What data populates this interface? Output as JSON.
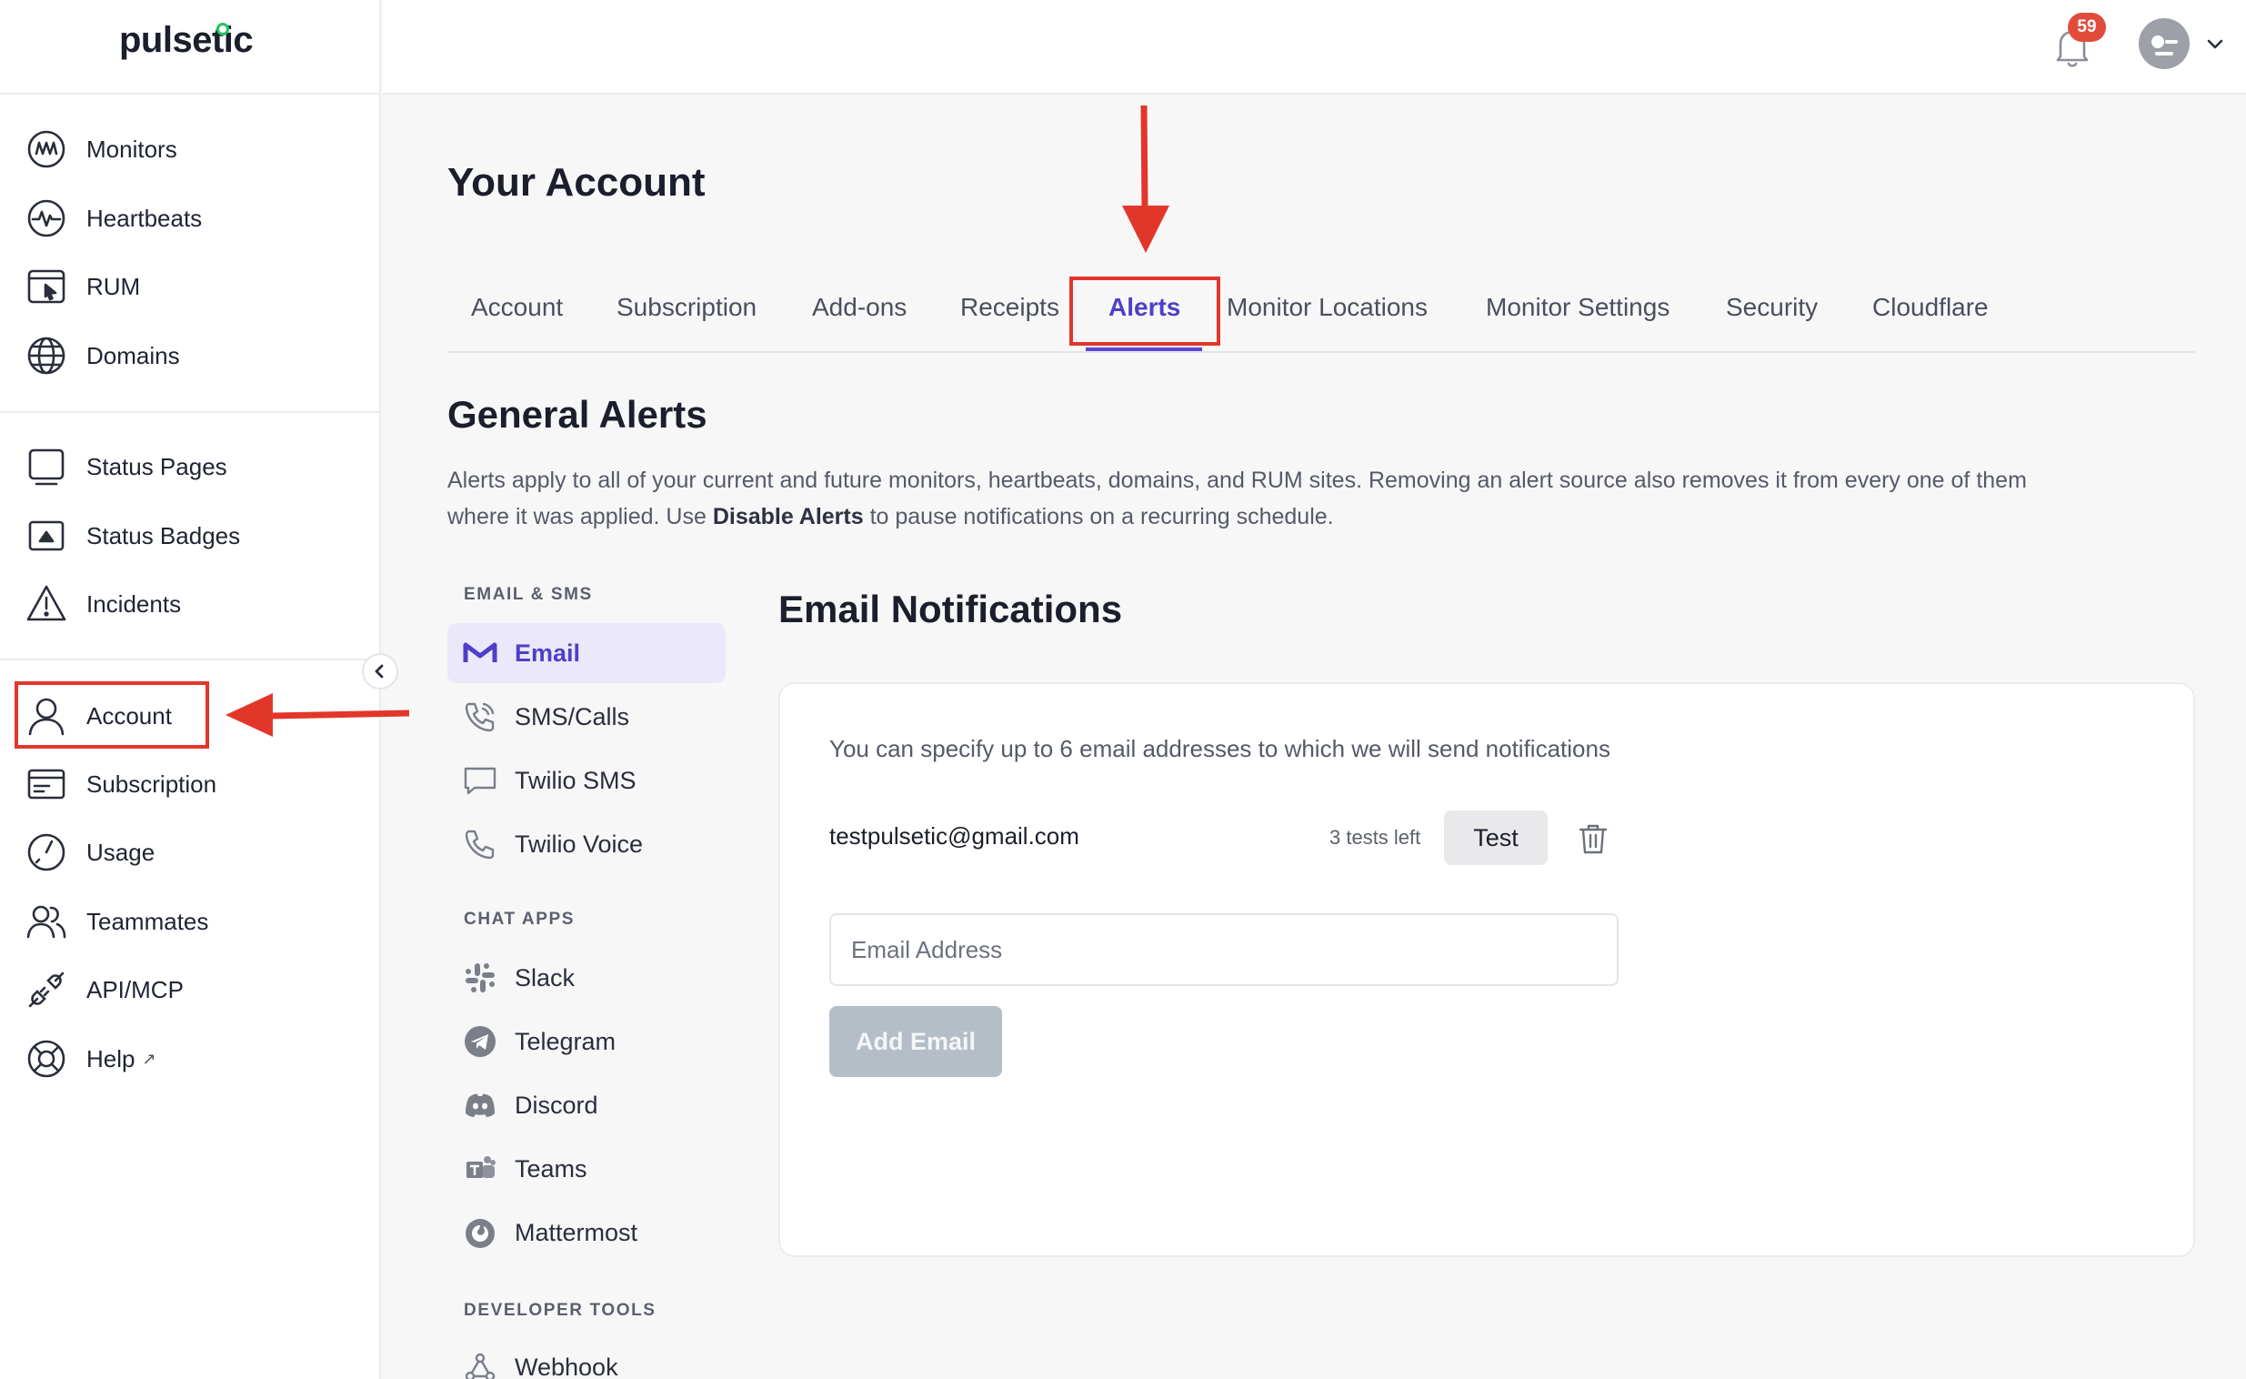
{
  "brand": {
    "name": "pulsetic"
  },
  "sidebar": {
    "groups": [
      [
        {
          "label": "Monitors",
          "icon": "monitors-icon"
        },
        {
          "label": "Heartbeats",
          "icon": "heartbeat-icon"
        },
        {
          "label": "RUM",
          "icon": "rum-icon"
        },
        {
          "label": "Domains",
          "icon": "globe-icon"
        }
      ],
      [
        {
          "label": "Status Pages",
          "icon": "status-page-icon"
        },
        {
          "label": "Status Badges",
          "icon": "status-badge-icon"
        },
        {
          "label": "Incidents",
          "icon": "warning-icon"
        }
      ],
      [
        {
          "label": "Account",
          "icon": "user-icon"
        },
        {
          "label": "Subscription",
          "icon": "card-icon"
        },
        {
          "label": "Usage",
          "icon": "gauge-icon"
        },
        {
          "label": "Teammates",
          "icon": "users-icon"
        },
        {
          "label": "API/MCP",
          "icon": "plug-icon"
        },
        {
          "label": "Help",
          "icon": "lifebuoy-icon",
          "external": "↗"
        }
      ]
    ]
  },
  "topbar": {
    "notification_count": "59"
  },
  "page": {
    "title": "Your Account"
  },
  "tabs": [
    {
      "label": "Account",
      "active": false
    },
    {
      "label": "Subscription",
      "active": false
    },
    {
      "label": "Add-ons",
      "active": false
    },
    {
      "label": "Receipts",
      "active": false
    },
    {
      "label": "Alerts",
      "active": true
    },
    {
      "label": "Monitor Locations",
      "active": false
    },
    {
      "label": "Monitor Settings",
      "active": false
    },
    {
      "label": "Security",
      "active": false
    },
    {
      "label": "Cloudflare",
      "active": false
    }
  ],
  "general": {
    "title": "General Alerts",
    "desc_before": "Alerts apply to all of your current and future monitors, heartbeats, domains, and RUM sites. Removing an alert source also removes it from every one of them where it was applied. Use ",
    "desc_bold": "Disable Alerts",
    "desc_after": " to pause notifications on a recurring schedule."
  },
  "alert_sources": {
    "email_sms_heading": "EMAIL & SMS",
    "email_sms": [
      {
        "label": "Email",
        "icon": "gmail-icon",
        "active": true
      },
      {
        "label": "SMS/Calls",
        "icon": "phone-icon",
        "active": false
      },
      {
        "label": "Twilio SMS",
        "icon": "message-icon",
        "active": false
      },
      {
        "label": "Twilio Voice",
        "icon": "phone-outline-icon",
        "active": false
      }
    ],
    "chat_heading": "CHAT APPS",
    "chat": [
      {
        "label": "Slack",
        "icon": "slack-icon"
      },
      {
        "label": "Telegram",
        "icon": "telegram-icon"
      },
      {
        "label": "Discord",
        "icon": "discord-icon"
      },
      {
        "label": "Teams",
        "icon": "teams-icon"
      },
      {
        "label": "Mattermost",
        "icon": "mattermost-icon"
      }
    ],
    "dev_heading": "DEVELOPER TOOLS",
    "dev": [
      {
        "label": "Webhook",
        "icon": "webhook-icon"
      }
    ]
  },
  "email_panel": {
    "title": "Email Notifications",
    "description": "You can specify up to 6 email addresses to which we will send notifications",
    "address": "testpulsetic@gmail.com",
    "tests_left": "3 tests left",
    "test_label": "Test",
    "input_placeholder": "Email Address",
    "add_label": "Add Email"
  },
  "colors": {
    "accent": "#5b46d6",
    "highlight": "#e3362a",
    "badge": "#e14b3b"
  }
}
